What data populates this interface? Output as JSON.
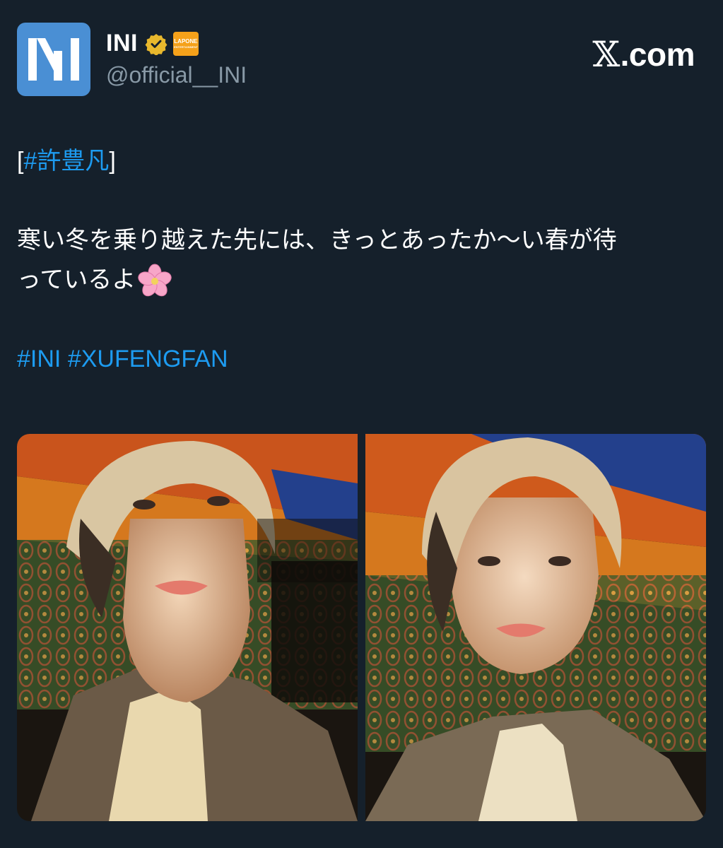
{
  "account": {
    "display_name": "INI",
    "handle": "@official__INI",
    "verified_icon": "verified-badge-icon",
    "affiliate_badge_text": "LAPONE",
    "affiliate_badge_sub": "ENTERTAINMENT"
  },
  "site": {
    "logo_x": "𝕏",
    "logo_text": ".com"
  },
  "tweet": {
    "hashtag_member": "#許豊凡",
    "bracket_open": "[",
    "bracket_close": "]",
    "body_line1": "寒い冬を乗り越えた先には、きっとあったか〜い春が待",
    "body_line2": "っているよ",
    "emoji": "cherry-blossom-icon",
    "hashtag_group": "#INI",
    "hashtag_member_en": "#XUFENGFAN"
  },
  "media": {
    "photos": [
      {
        "name": "selfie-photo-1"
      },
      {
        "name": "selfie-photo-2"
      }
    ]
  },
  "colors": {
    "background": "#15202b",
    "link": "#1d9bf0",
    "muted": "#8899a6",
    "verified": "#e8b82d",
    "avatar": "#4a8fd4"
  }
}
